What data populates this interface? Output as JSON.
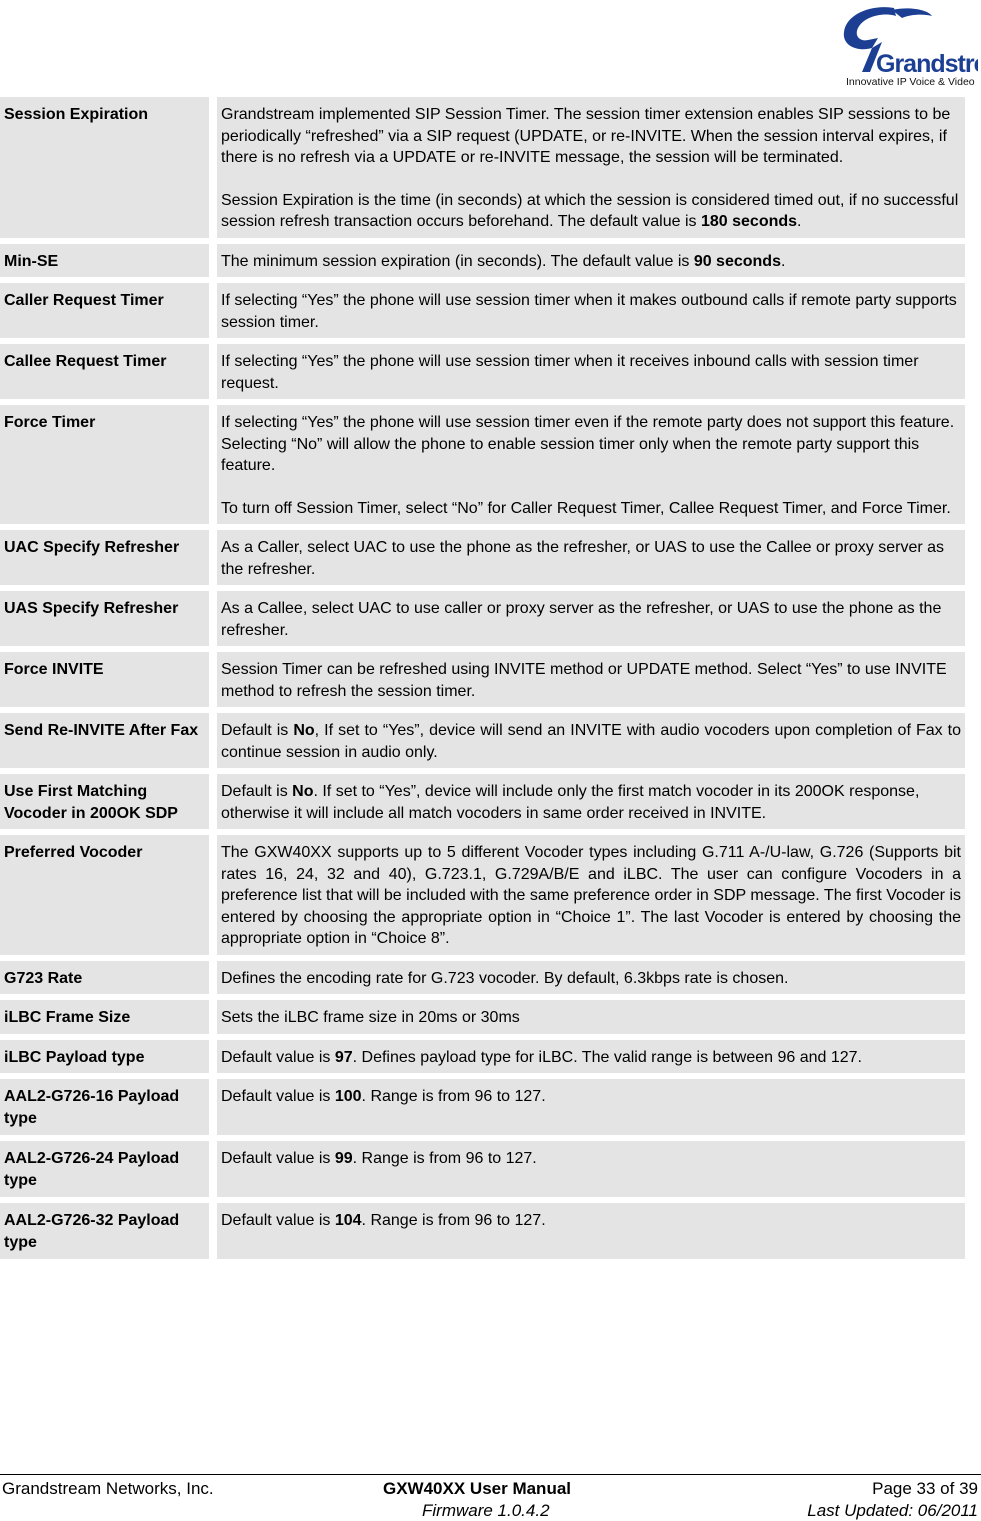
{
  "logo": {
    "brand": "Grandstream",
    "tagline": "Innovative IP Voice & Video",
    "brand_color": "#1c3f94"
  },
  "rows": [
    {
      "label": "Session Expiration",
      "paras": [
        [
          {
            "t": "Grandstream implemented SIP Session Timer. The session timer extension enables SIP sessions to be periodically “refreshed” via a SIP request (UPDATE, or re-INVITE. When the session interval expires, if there is no refresh via a UPDATE or re-INVITE message, the session will be terminated."
          }
        ],
        [
          {
            "t": "Session Expiration is the time (in seconds) at which the session is considered timed out, if no successful session refresh transaction occurs beforehand. The default value is "
          },
          {
            "t": "180 seconds",
            "b": true
          },
          {
            "t": "."
          }
        ]
      ]
    },
    {
      "label": "Min-SE",
      "paras": [
        [
          {
            "t": "The minimum session expiration (in seconds).  The default value is "
          },
          {
            "t": "90 seconds",
            "b": true
          },
          {
            "t": "."
          }
        ]
      ]
    },
    {
      "label": "Caller Request Timer",
      "paras": [
        [
          {
            "t": "If selecting “Yes” the phone will use session timer when it makes outbound calls if remote party supports session timer."
          }
        ]
      ]
    },
    {
      "label": "Callee Request Timer",
      "paras": [
        [
          {
            "t": "If selecting “Yes” the phone will use session timer when it receives inbound calls with session timer request."
          }
        ]
      ]
    },
    {
      "label": "Force Timer",
      "paras": [
        [
          {
            "t": "If selecting “Yes” the phone will use session timer even if the remote party does not support this feature. Selecting “No” will allow the phone to enable session timer only when the remote party support this feature."
          }
        ],
        [
          {
            "t": "To turn off Session Timer, select “No” for Caller Request Timer, Callee Request Timer, and Force Timer."
          }
        ]
      ]
    },
    {
      "label": "UAC Specify Refresher",
      "paras": [
        [
          {
            "t": "As a Caller, select UAC to use the phone as the refresher, or UAS to use the Callee or proxy server as the refresher."
          }
        ]
      ]
    },
    {
      "label": "UAS Specify Refresher",
      "paras": [
        [
          {
            "t": "As a Callee, select UAC to use caller or proxy server as the refresher, or UAS to use the phone as the refresher."
          }
        ]
      ]
    },
    {
      "label": "Force INVITE",
      "paras": [
        [
          {
            "t": "Session Timer can be refreshed using INVITE method or UPDATE method. Select “Yes” to use INVITE method to refresh the session timer."
          }
        ]
      ]
    },
    {
      "label": "Send Re-INVITE After Fax",
      "justify": true,
      "paras": [
        [
          {
            "t": "Default is "
          },
          {
            "t": "No",
            "b": true
          },
          {
            "t": ", If set to “Yes”, device will send an INVITE with audio vocoders upon completion of Fax to continue session in audio only."
          }
        ]
      ]
    },
    {
      "label": "Use First Matching Vocoder in 200OK SDP",
      "paras": [
        [
          {
            "t": "Default is "
          },
          {
            "t": "No",
            "b": true
          },
          {
            "t": ". If set to “Yes”, device will include only the first match vocoder in its 200OK response, otherwise it will include all match vocoders in same order received in INVITE."
          }
        ]
      ]
    },
    {
      "label": "Preferred Vocoder",
      "justify": true,
      "paras": [
        [
          {
            "t": "The GXW40XX supports up to 5 different Vocoder types including G.711 A-/U-law, G.726 (Supports bit rates 16, 24, 32 and 40), G.723.1, G.729A/B/E and iLBC.  The user can configure Vocoders in a preference list that will be included with the same preference order in SDP message.  The first Vocoder is entered by choosing the appropriate option in “Choice 1”.  The last Vocoder is entered by choosing the appropriate option in “Choice 8”."
          }
        ]
      ]
    },
    {
      "label": "G723 Rate",
      "paras": [
        [
          {
            "t": "Defines the encoding rate for G.723 vocoder. By default, 6.3kbps rate is chosen."
          }
        ]
      ]
    },
    {
      "label": "iLBC Frame Size",
      "paras": [
        [
          {
            "t": "Sets the iLBC frame size in 20ms or 30ms"
          }
        ]
      ]
    },
    {
      "label": "iLBC Payload type",
      "justify": true,
      "paras": [
        [
          {
            "t": "Default value is "
          },
          {
            "t": "97",
            "b": true
          },
          {
            "t": ". Defines payload type for iLBC. The valid range is between 96 and 127."
          }
        ]
      ]
    },
    {
      "label": "AAL2-G726-16 Payload type",
      "tall": true,
      "paras": [
        [
          {
            "t": "Default value is "
          },
          {
            "t": "100",
            "b": true
          },
          {
            "t": ". Range is from 96 to 127."
          }
        ]
      ]
    },
    {
      "label": "AAL2-G726-24 Payload type",
      "tall": true,
      "paras": [
        [
          {
            "t": "Default value is "
          },
          {
            "t": "99",
            "b": true
          },
          {
            "t": ". Range is from 96 to 127."
          }
        ]
      ]
    },
    {
      "label": "AAL2-G726-32 Payload type",
      "tall": true,
      "paras": [
        [
          {
            "t": "Default value is "
          },
          {
            "t": "104",
            "b": true
          },
          {
            "t": ". Range is from 96 to 127."
          }
        ]
      ]
    }
  ],
  "footer": {
    "company": "Grandstream Networks, Inc.",
    "manual": "GXW40XX User Manual",
    "firmware": "Firmware 1.0.4.2",
    "page": "Page 33 of 39",
    "updated": "Last Updated:  06/2011"
  }
}
